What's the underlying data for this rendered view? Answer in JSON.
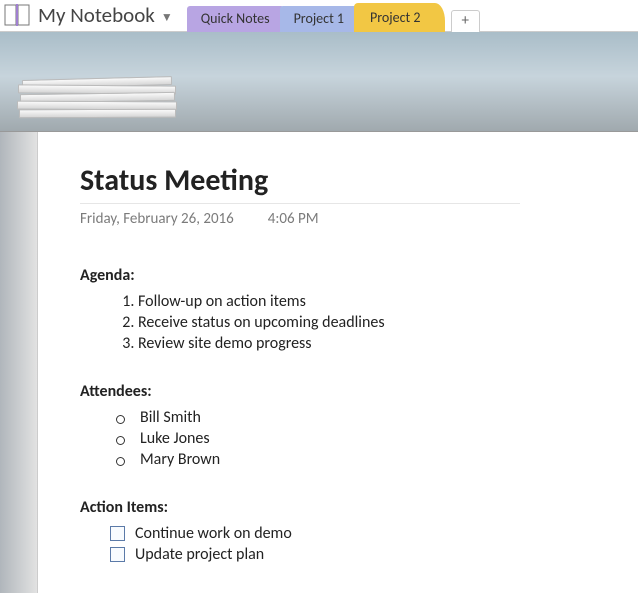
{
  "header": {
    "notebook_title": "My Notebook",
    "tabs": [
      {
        "label": "Quick Notes",
        "color": "purple",
        "active": false
      },
      {
        "label": "Project 1",
        "color": "blue",
        "active": false
      },
      {
        "label": "Project 2",
        "color": "yellow",
        "active": true
      }
    ],
    "add_tab_label": "+"
  },
  "page": {
    "title": "Status Meeting",
    "date": "Friday, February 26, 2016",
    "time": "4:06 PM",
    "sections": {
      "agenda_heading": "Agenda:",
      "agenda_items": [
        "Follow-up on action items",
        "Receive status on upcoming deadlines",
        "Review site demo progress"
      ],
      "attendees_heading": "Attendees:",
      "attendees": [
        "Bill Smith",
        "Luke Jones",
        "Mary Brown"
      ],
      "action_heading": "Action Items:",
      "action_items": [
        {
          "label": "Continue work on demo",
          "checked": false
        },
        {
          "label": "Update project plan",
          "checked": false
        }
      ]
    }
  }
}
